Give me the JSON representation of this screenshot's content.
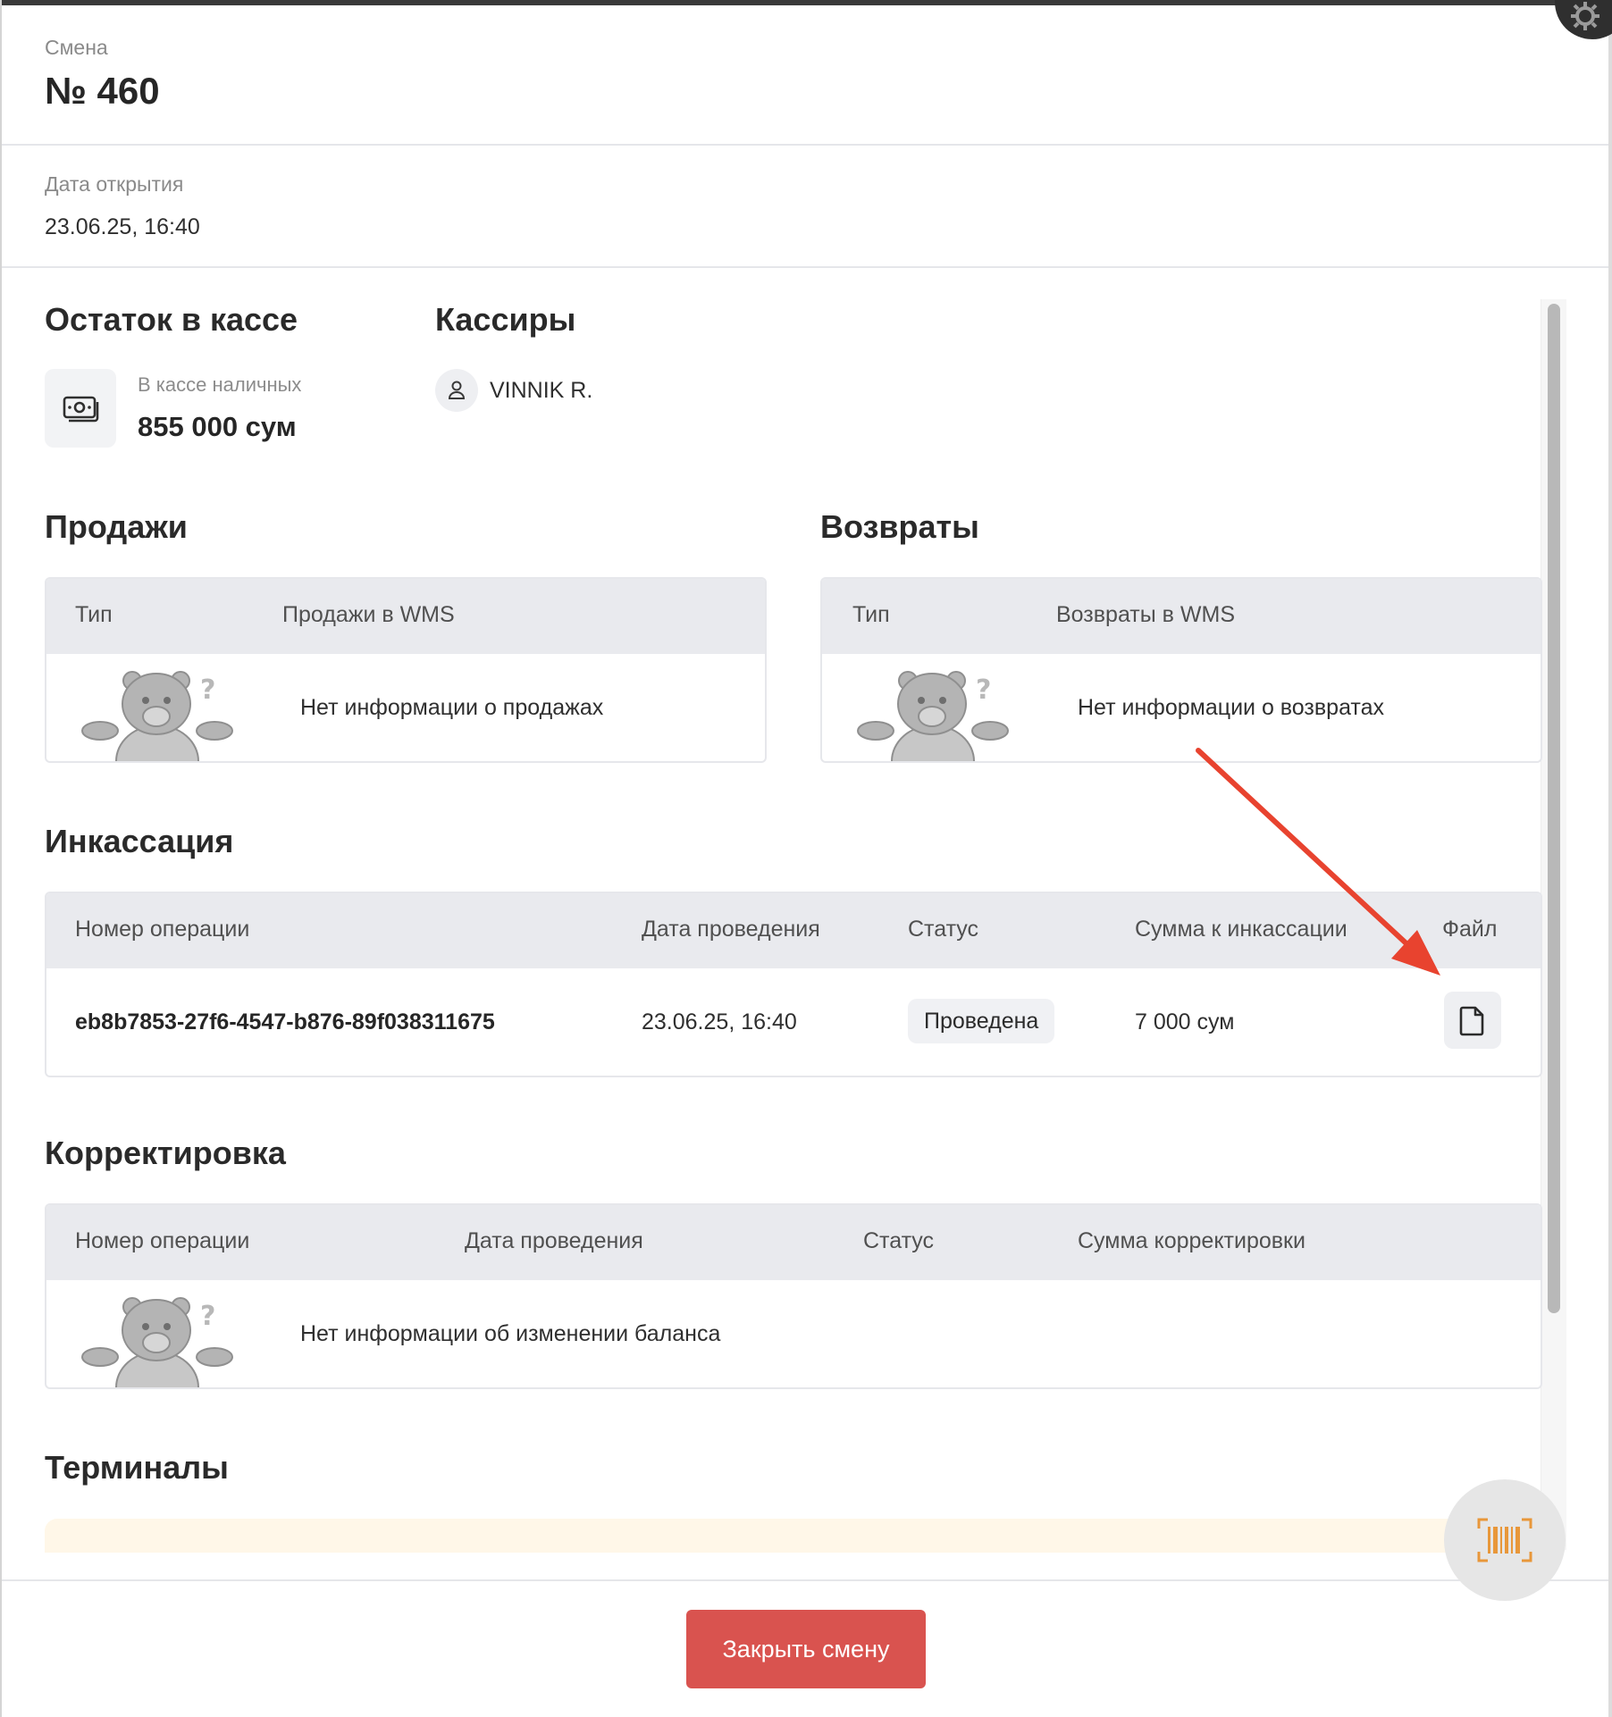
{
  "shift": {
    "label": "Смена",
    "number": "№ 460"
  },
  "opened": {
    "label": "Дата открытия",
    "value": "23.06.25, 16:40"
  },
  "balance": {
    "title": "Остаток в кассе",
    "cash_label": "В кассе наличных",
    "cash_value": "855 000 сум"
  },
  "cashiers": {
    "title": "Кассиры",
    "items": [
      {
        "name": "VINNIK R."
      }
    ]
  },
  "sales": {
    "title": "Продажи",
    "columns": [
      "Тип",
      "Продажи в WMS"
    ],
    "empty_text": "Нет информации о продажах"
  },
  "returns": {
    "title": "Возвраты",
    "columns": [
      "Тип",
      "Возвраты в WMS"
    ],
    "empty_text": "Нет информации о возвратах"
  },
  "collection": {
    "title": "Инкассация",
    "columns": [
      "Номер операции",
      "Дата проведения",
      "Статус",
      "Сумма к инкассации",
      "Файл"
    ],
    "rows": [
      {
        "operation_id": "eb8b7853-27f6-4547-b876-89f038311675",
        "date": "23.06.25, 16:40",
        "status": "Проведена",
        "amount": "7 000 сум",
        "file_icon": "document-icon"
      }
    ]
  },
  "correction": {
    "title": "Корректировка",
    "columns": [
      "Номер операции",
      "Дата проведения",
      "Статус",
      "Сумма корректировки"
    ],
    "empty_text": "Нет информации об изменении баланса"
  },
  "terminals": {
    "title": "Терминалы"
  },
  "footer": {
    "close_label": "Закрыть смену"
  },
  "icons": {
    "cash": "cash-icon",
    "cashier": "user-icon",
    "scanner": "barcode-scanner-icon",
    "empty_state": "bear-mascot-icon"
  },
  "colors": {
    "primary_button": "#d9534f",
    "annotation_arrow": "#e8432f",
    "scanner_accent": "#e8973a",
    "table_header": "#e9eaee"
  }
}
